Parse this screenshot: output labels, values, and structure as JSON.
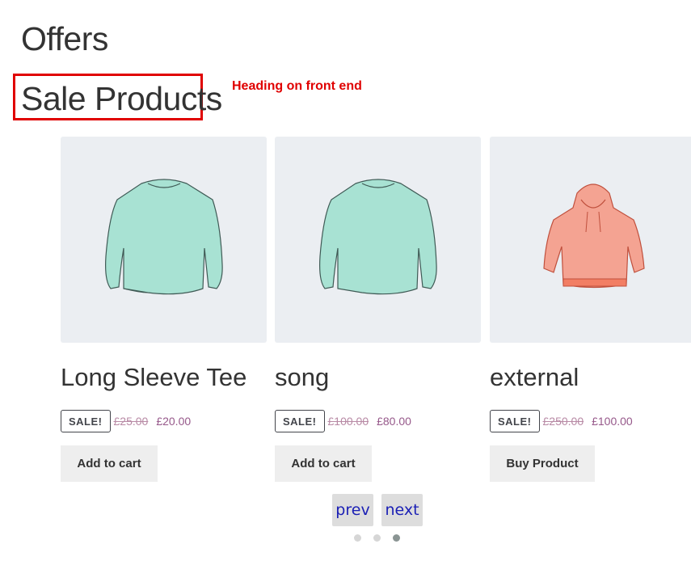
{
  "page": {
    "title": "Offers"
  },
  "section": {
    "title": "Sale Products"
  },
  "annotation": {
    "text": "Heading on front end",
    "color": "#e00000"
  },
  "products": [
    {
      "name": "Long Sleeve Tee",
      "badge": "SALE!",
      "old_price": "£25.00",
      "price": "£20.00",
      "button": "Add to cart",
      "image": "long-sleeve-tee-icon"
    },
    {
      "name": "song",
      "badge": "SALE!",
      "old_price": "£100.00",
      "price": "£80.00",
      "button": "Add to cart",
      "image": "long-sleeve-tee-icon"
    },
    {
      "name": "external",
      "badge": "SALE!",
      "old_price": "£250.00",
      "price": "£100.00",
      "button": "Buy Product",
      "image": "hoodie-icon"
    }
  ],
  "navigation": {
    "prev": "prev",
    "next": "next"
  },
  "pagination": {
    "pages": 3,
    "active_page": 3
  },
  "colors": {
    "price": "#96588a",
    "image_bg": "#ebeef2",
    "tee": "#a8e2d3",
    "hoodie": "#f4a392"
  }
}
